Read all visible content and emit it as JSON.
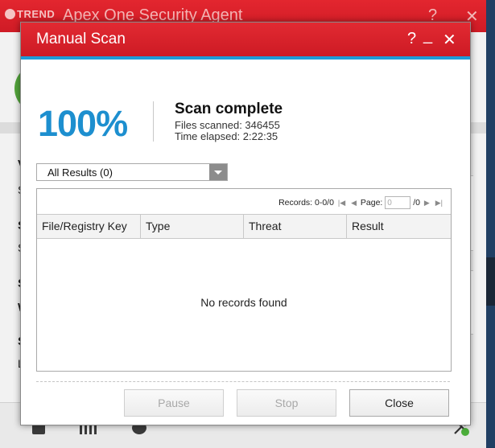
{
  "background_window": {
    "title": "Apex One Security Agent",
    "brand": "TREND",
    "help_glyph": "?",
    "close_glyph": "✕",
    "side_letters": [
      "V",
      "S",
      "S",
      "S",
      "S",
      "S",
      "W",
      "S",
      "L"
    ]
  },
  "dialog": {
    "title": "Manual Scan",
    "controls": {
      "help": "?",
      "minimize": "_",
      "close": "✕"
    }
  },
  "summary": {
    "percent": "100%",
    "status_title": "Scan complete",
    "files_scanned": "Files scanned: 346455",
    "time_elapsed": "Time elapsed: 2:22:35"
  },
  "filter": {
    "selected": "All Results (0)"
  },
  "pager": {
    "records": "Records: 0-0/0",
    "page_label": "Page:",
    "page_value": "0",
    "page_total": "/0"
  },
  "table": {
    "columns": [
      "File/Registry Key",
      "Type",
      "Threat",
      "Result"
    ],
    "empty_message": "No records found"
  },
  "buttons": {
    "pause": "Pause",
    "stop": "Stop",
    "close": "Close"
  },
  "colors": {
    "brand_red": "#d9202a",
    "accent_blue": "#1d8fcf",
    "status_green": "#53a53b"
  }
}
